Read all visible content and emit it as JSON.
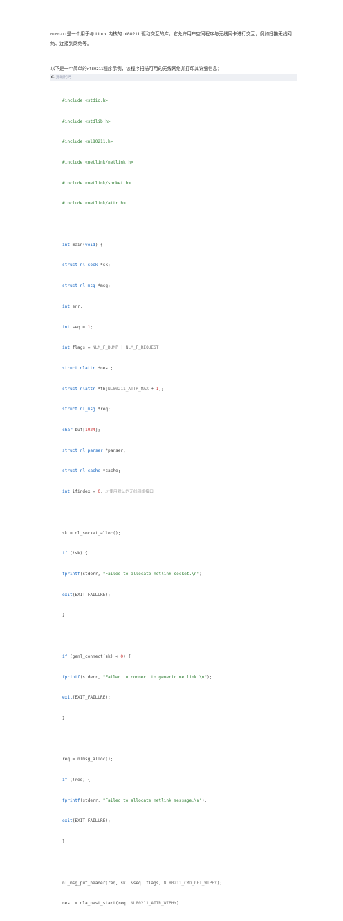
{
  "intro": {
    "lib_name": "nl80211",
    "text_1": "是一个用于与",
    "os_name": "Linux",
    "text_2": "内核的",
    "driver_name": "nl80211",
    "text_3": "驱动交互的库。它允许用户空间程序与无线网卡进行交互，例如扫描无线网络、连接到网络等。"
  },
  "lead": {
    "text_1": "以下是一个简单的",
    "lib_name": "nl80211",
    "text_2": "程序示例，该程序扫描可用的无线网络并打印其详细信息："
  },
  "code_header": {
    "language": "C",
    "copy_label": "复制代码"
  },
  "code": {
    "includes": [
      "stdio.h",
      "stdlib.h",
      "nl80211.h",
      "netlink/netlink.h",
      "netlink/socket.h",
      "netlink/attr.h"
    ],
    "l_main_1": "int",
    "l_main_2": " main(",
    "l_main_3": "void",
    "l_main_4": ") {",
    "l_sk_1": "struct nl_sock",
    "l_sk_2": " *sk;",
    "l_msg_1": "struct nl_msg",
    "l_msg_2": " *msg;",
    "l_err_1": "int",
    "l_err_2": " err;",
    "l_seq_1": "int",
    "l_seq_2": " seq = ",
    "l_seq_3": "1",
    "l_seq_4": ";",
    "l_flags_1": "int",
    "l_flags_2": " flags = ",
    "l_flags_3": "NLM_F_DUMP | NLM_F_REQUEST",
    "l_flags_4": ";",
    "l_nest_1": "struct nlattr",
    "l_nest_2": " *nest;",
    "l_tb_1": "struct nlattr",
    "l_tb_2": " *tb[",
    "l_tb_3": "NL80211_ATTR_MAX",
    "l_tb_4": " + ",
    "l_tb_5": "1",
    "l_tb_6": "];",
    "l_req_1": "struct nl_msg",
    "l_req_2": " *req;",
    "l_buf_1": "char",
    "l_buf_2": " buf[",
    "l_buf_3": "1024",
    "l_buf_4": "];",
    "l_parser_1": "struct nl_parser",
    "l_parser_2": " *parser;",
    "l_cache_1": "struct nl_cache",
    "l_cache_2": " *cache;",
    "l_if_1": "int",
    "l_if_2": " ifindex = ",
    "l_if_3": "0",
    "l_if_4": "; ",
    "l_if_5": "// 使用默认的无线网络接口",
    "l_alloc": "sk = nl_socket_alloc();",
    "l_if_sk_1": "if",
    "l_if_sk_2": " (!sk) {",
    "l_fp1_1": "fprintf",
    "l_fp1_2": "(stderr, ",
    "l_fp1_3": "\"Failed to allocate netlink socket.\\n\"",
    "l_fp1_4": ");",
    "l_exit1_1": "exit",
    "l_exit1_2": "(EXIT_FAILURE);",
    "l_close1": "}",
    "l_gc_1": "if",
    "l_gc_2": " (genl_connect(sk) < ",
    "l_gc_3": "0",
    "l_gc_4": ") {",
    "l_fp2_1": "fprintf",
    "l_fp2_2": "(stderr, ",
    "l_fp2_3": "\"Failed to connect to generic netlink.\\n\"",
    "l_fp2_4": ");",
    "l_exit2_1": "exit",
    "l_exit2_2": "(EXIT_FAILURE);",
    "l_close2": "}",
    "l_nlalloc": "req = nlmsg_alloc();",
    "l_if_req_1": "if",
    "l_if_req_2": " (!req) {",
    "l_fp3_1": "fprintf",
    "l_fp3_2": "(stderr, ",
    "l_fp3_3": "\"Failed to allocate netlink message.\\n\"",
    "l_fp3_4": ");",
    "l_exit3_1": "exit",
    "l_exit3_2": "(EXIT_FAILURE);",
    "l_close3": "}",
    "l_put_1": "nl_msg_put_header(req, sk, &seq, flags, ",
    "l_put_2": "NL80211_CMD_GET_WIPHY",
    "l_put_3": ");",
    "l_nst_1": "nest = nla_nest_start(req, ",
    "l_nst_2": "NL80211_ATTR_WIPHY",
    "l_nst_3": ");"
  }
}
